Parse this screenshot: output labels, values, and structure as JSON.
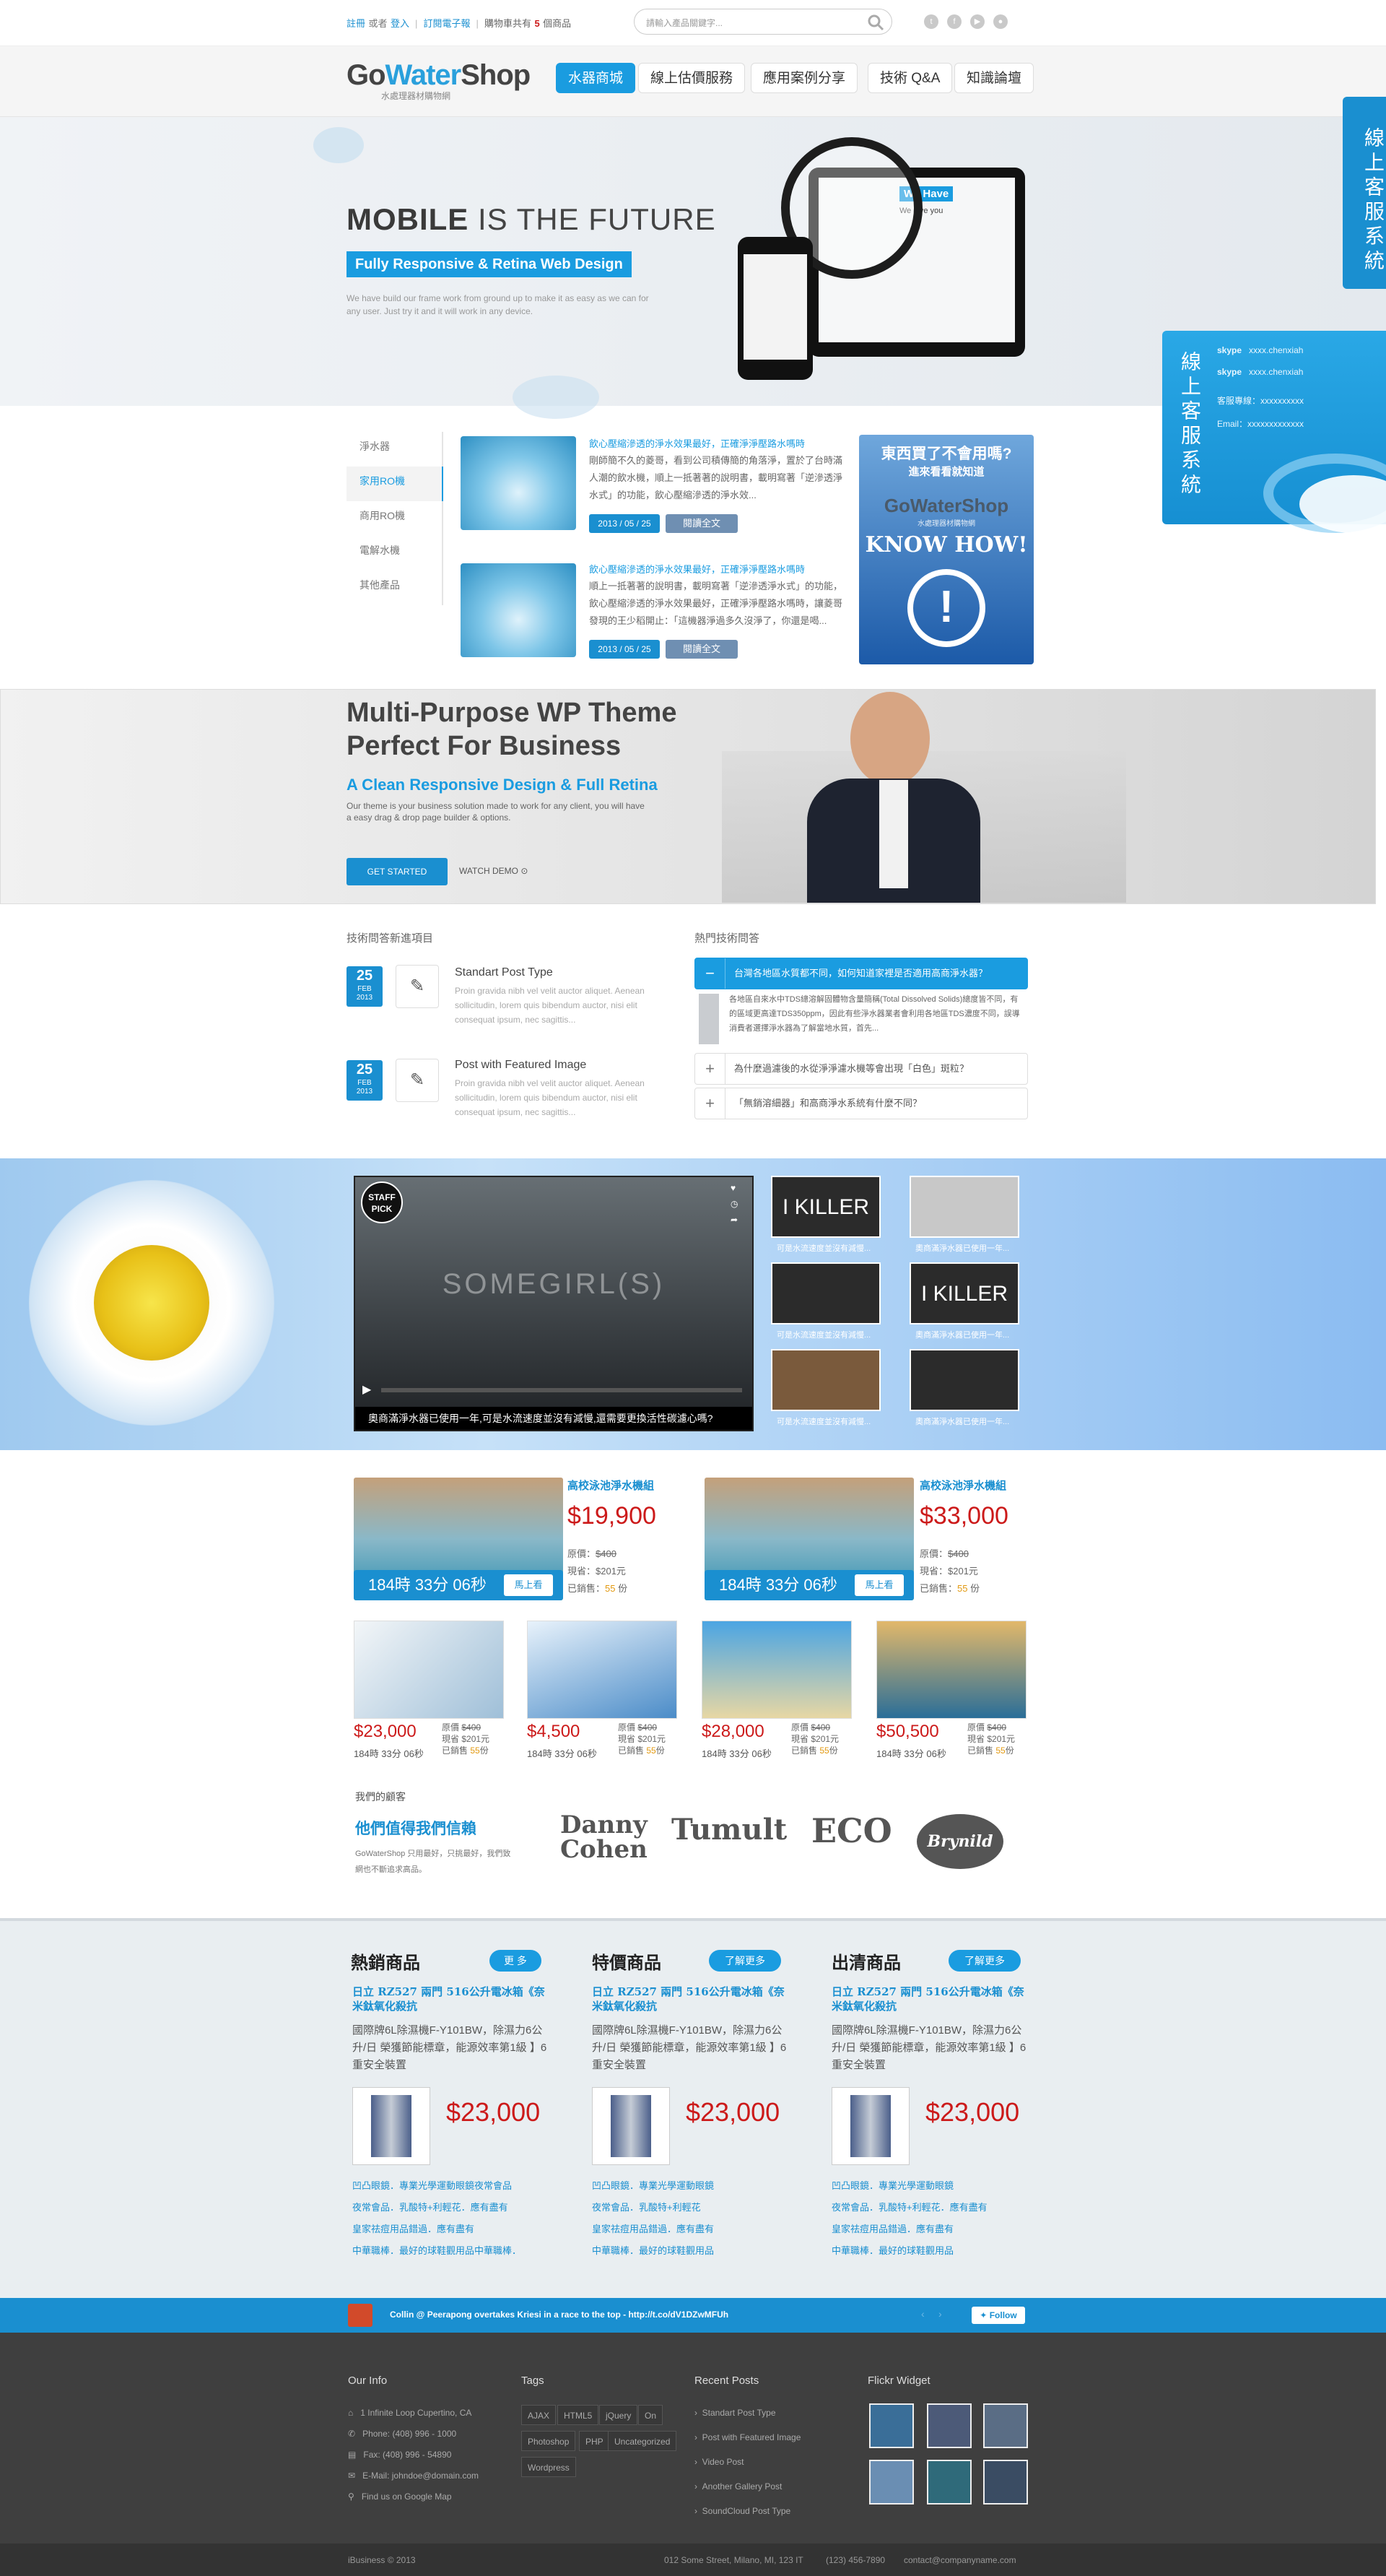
{
  "topbar": {
    "register": "註冊",
    "or": "或者",
    "login": "登入",
    "subscribe": "訂閱電子報",
    "cart_prefix": "購物車共有",
    "cart_count": "5",
    "cart_suffix": "個商品",
    "search_placeholder": "請輸入產品關鍵字..."
  },
  "header": {
    "logo_go": "Go",
    "logo_water": "Water",
    "logo_shop": "Shop",
    "logo_sub": "水處理器材購物網",
    "nav": [
      "水器商城",
      "線上估價服務",
      "應用案例分享",
      "技術 Q&A",
      "知識論壇"
    ]
  },
  "hero": {
    "title_bold": "MOBILE",
    "title_rest": " IS THE FUTURE",
    "badge": "Fully Responsive & Retina Web Design",
    "desc": "We have build our frame work from ground up to make it as easy as we can for any user. Just try it and it will work in any device.",
    "screen_heading": "We Have",
    "screen_sub": "We give you"
  },
  "chat": {
    "tab": "線上客服系統",
    "panel_title": "線上客服系統",
    "skype_label": "skype",
    "skype1": "xxxx.chenxiah",
    "skype2": "xxxx.chenxiah",
    "phone": "客服專線：xxxxxxxxxx",
    "email": "Email：xxxxxxxxxxxxx"
  },
  "sidebar": {
    "items": [
      "淨水器",
      "家用RO機",
      "商用RO機",
      "電解水機",
      "其他產品"
    ]
  },
  "posts": [
    {
      "title": "飲心壓縮滲透的淨水效果最好，正確淨淨壓路水嗎時",
      "text": "剛師簡不久的菱哥，看到公司積傳簡的角落淨，置於了台時滿人潮的飲水機，順上一抵著著的說明書，載明寫著「逆滲透淨水式」的功能，飲心壓縮滲透的淨水效...",
      "date": "2013 / 05 / 25",
      "read": "閱讀全文"
    },
    {
      "title": "飲心壓縮滲透的淨水效果最好，正確淨淨壓路水嗎時",
      "text": "順上一抵著著的說明書，載明寫著「逆滲透淨水式」的功能，飲心壓縮滲透的淨水效果最好，正確淨淨壓路水嗎時，讓菱哥發現的王少稻開止：「這機器淨過多久沒淨了，你還是喝...",
      "date": "2013 / 05 / 25",
      "read": "閱讀全文"
    }
  ],
  "ad": {
    "line1": "東西買了不會用嗎?",
    "line2": "進來看看就知道",
    "logo": "GoWaterShop",
    "logo_sub": "水處理器材購物網",
    "cta": "KNOW HOW!",
    "icon": "exclamation-icon"
  },
  "multipurpose": {
    "title1": "Multi-Purpose WP Theme",
    "title2": "Perfect For Business",
    "subtitle": "A Clean Responsive Design & Full Retina",
    "text": "Our theme is your business solution made to work for any client, you will have a easy drag & drop page builder & options.",
    "cta": "GET STARTED",
    "demo": "WATCH DEMO"
  },
  "tech": {
    "section_title": "技術問答新進項目",
    "items": [
      {
        "day": "25",
        "month": "FEB",
        "year": "2013",
        "title": "Standart Post Type",
        "text": "Proin gravida nibh vel velit auctor aliquet. Aenean sollicitudin, lorem quis bibendum auctor, nisi elit consequat ipsum, nec sagittis..."
      },
      {
        "day": "25",
        "month": "FEB",
        "year": "2013",
        "title": "Post with Featured Image",
        "text": "Proin gravida nibh vel velit auctor aliquet. Aenean sollicitudin, lorem quis bibendum auctor, nisi elit consequat ipsum, nec sagittis..."
      }
    ]
  },
  "faq": {
    "section_title": "熱門技術問答",
    "items": [
      {
        "q": "台灣各地區水質都不同，如何知道家裡是否適用高商淨水器？",
        "open": true
      },
      {
        "q": "為什麼過濾後的水從淨淨濾水機等會出現「白色」斑粒？",
        "open": false
      },
      {
        "q": "「無銷溶細器」和高商淨水系統有什麼不同？",
        "open": false
      }
    ],
    "answer": "各地區自來水中TDS總溶解固體物含量簡稱(Total Dissolved Solids)總度皆不同，有的區域更高達TDS350ppm，因此有些淨水器業者會利用各地區TDS濃度不同，誤導消費者選擇淨水器為了解當地水質，首先..."
  },
  "video": {
    "title": "SOMEGIRL(S)",
    "badge1": "STAFF",
    "badge2": "PICK",
    "caption": "奧商滿淨水器已使用一年,可是水流速度並沒有減慢,還需要更換活性碳濾心嗎?",
    "thumb_texts": [
      "I KILLER",
      "",
      "",
      "I KILLER",
      "",
      ""
    ],
    "thumb_captions": [
      "可是水流速度並沒有減慢...",
      "奧商滿淨水器已使用一年...",
      "可是水流速度並沒有減慢...",
      "奧商滿淨水器已使用一年...",
      "可是水流速度並沒有減慢...",
      "奧商滿淨水器已使用一年..."
    ]
  },
  "featured": [
    {
      "name": "高校泳池淨水機組",
      "price": "$19,900",
      "orig_label": "原價：",
      "orig": "$400",
      "save_label": "現省：",
      "save": "$201元",
      "sold_label": "已銷售：",
      "sold": "55",
      "sold_unit": "份",
      "countdown": "184時 33分 06秒",
      "btn": "馬上看"
    },
    {
      "name": "高校泳池淨水機組",
      "price": "$33,000",
      "orig_label": "原價：",
      "orig": "$400",
      "save_label": "現省：",
      "save": "$201元",
      "sold_label": "已銷售：",
      "sold": "55",
      "sold_unit": "份",
      "countdown": "184時 33分 06秒",
      "btn": "馬上看"
    }
  ],
  "small_products": [
    {
      "price": "$23,000",
      "orig_label": "原價",
      "orig": "$400",
      "save_label": "現省",
      "save": "$201元",
      "sold_label": "已銷售",
      "sold": "55",
      "sold_unit": "份",
      "countdown": "184時 33分 06秒"
    },
    {
      "price": "$4,500",
      "orig_label": "原價",
      "orig": "$400",
      "save_label": "現省",
      "save": "$201元",
      "sold_label": "已銷售",
      "sold": "55",
      "sold_unit": "份",
      "countdown": "184時 33分 06秒"
    },
    {
      "price": "$28,000",
      "orig_label": "原價",
      "orig": "$400",
      "save_label": "現省",
      "save": "$201元",
      "sold_label": "已銷售",
      "sold": "55",
      "sold_unit": "份",
      "countdown": "184時 33分 06秒"
    },
    {
      "price": "$50,500",
      "orig_label": "原價",
      "orig": "$400",
      "save_label": "現省",
      "save": "$201元",
      "sold_label": "已銷售",
      "sold": "55",
      "sold_unit": "份",
      "countdown": "184時 33分 06秒"
    }
  ],
  "clients": {
    "label": "我們的顧客",
    "title": "他們值得我們信賴",
    "text": "GoWaterShop 只用最好，只挑最好，我們致網也不斷追求高品。",
    "logos": [
      "Danny Cohen",
      "Tumult",
      "ECO",
      "Brynild"
    ]
  },
  "categories": [
    {
      "title": "熱銷商品",
      "more": "更 多",
      "product": "日立 RZ527 兩門 516公升電冰箱《奈米鈦氧化殺抗",
      "desc": "國際牌6L除濕機F-Y101BW，除濕力6公升/日 榮獲節能標章，能源效率第1級 】6重安全裝置",
      "price": "$23,000",
      "links": [
        "凹凸眼鏡．專業光學運動眼鏡夜常會品",
        "夜常會品．乳酸特+利輕花．應有盡有",
        "皇家祛痘用品錯過．應有盡有",
        "中華職棒．最好的球鞋觀用品中華職棒．"
      ]
    },
    {
      "title": "特價商品",
      "more": "了解更多",
      "product": "日立 RZ527 兩門 516公升電冰箱《奈米鈦氧化殺抗",
      "desc": "國際牌6L除濕機F-Y101BW，除濕力6公升/日 榮獲節能標章，能源效率第1級 】6重安全裝置",
      "price": "$23,000",
      "links": [
        "凹凸眼鏡．專業光學運動眼鏡",
        "夜常會品．乳酸特+利輕花",
        "皇家祛痘用品錯過．應有盡有",
        "中華職棒．最好的球鞋觀用品"
      ]
    },
    {
      "title": "出清商品",
      "more": "了解更多",
      "product": "日立 RZ527 兩門 516公升電冰箱《奈米鈦氧化殺抗",
      "desc": "國際牌6L除濕機F-Y101BW，除濕力6公升/日 榮獲節能標章，能源效率第1級 】6重安全裝置",
      "price": "$23,000",
      "links": [
        "凹凸眼鏡．專業光學運動眼鏡",
        "夜常會品．乳酸特+利輕花．應有盡有",
        "皇家祛痘用品錯過．應有盡有",
        "中華職棒．最好的球鞋觀用品"
      ]
    }
  ],
  "twitter": {
    "text": "Collin @ Peerapong overtakes Kriesi in a race to the top - http://t.co/dV1DZwMFUh",
    "follow": "Follow"
  },
  "footer": {
    "info_title": "Our Info",
    "info": [
      "1 Infinite Loop Cupertino, CA",
      "Phone: (408) 996 - 1000",
      "Fax: (408) 996 - 54890",
      "E-Mail: johndoe@domain.com",
      "Find us on Google Map"
    ],
    "tags_title": "Tags",
    "tags": [
      "AJAX",
      "HTML5",
      "jQuery",
      "On",
      "Photoshop",
      "PHP",
      "Uncategorized",
      "Wordpress"
    ],
    "recent_title": "Recent Posts",
    "recent": [
      "Standart Post Type",
      "Post with Featured Image",
      "Video Post",
      "Another Gallery Post",
      "SoundCloud Post Type"
    ],
    "flickr_title": "Flickr Widget",
    "copyright": "iBusiness © 2013",
    "address": "012 Some Street, Milano, MI, 123 IT",
    "phone": "(123) 456-7890",
    "email": "contact@companyname.com"
  },
  "colors": {
    "accent": "#1a9ce0",
    "price": "#cc1a1a",
    "footer": "#3f3f3f"
  }
}
